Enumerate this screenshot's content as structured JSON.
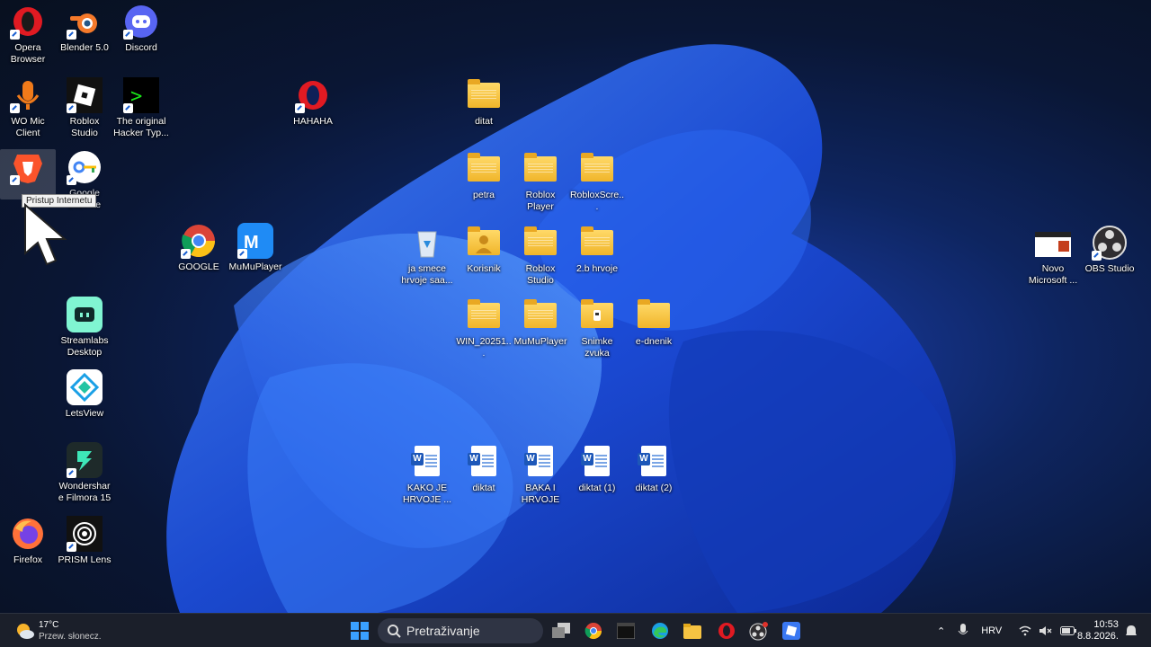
{
  "desktop": {
    "tooltip": "Pristup Internetu",
    "icons": [
      {
        "label": "Opera Browser"
      },
      {
        "label": "Blender 5.0"
      },
      {
        "label": "Discord"
      },
      {
        "label": "WO Mic Client"
      },
      {
        "label": "Roblox Studio"
      },
      {
        "label": "The original Hacker Typ..."
      },
      {
        "label": "HAHAHA"
      },
      {
        "label": "Brave"
      },
      {
        "label": "Google Lozinke"
      },
      {
        "label": "GOOGLE"
      },
      {
        "label": "MuMuPlayer"
      },
      {
        "label": "Streamlabs Desktop"
      },
      {
        "label": "LetsView"
      },
      {
        "label": "Wondershare Filmora 15"
      },
      {
        "label": "Firefox"
      },
      {
        "label": "PRISM Lens"
      },
      {
        "label": "ditat"
      },
      {
        "label": "petra"
      },
      {
        "label": "Roblox Player"
      },
      {
        "label": "RobloxScre..."
      },
      {
        "label": "ja smece hrvoje saa..."
      },
      {
        "label": "Korisnik"
      },
      {
        "label": "Roblox Studio"
      },
      {
        "label": "2.b hrvoje"
      },
      {
        "label": "WIN_20251..."
      },
      {
        "label": "MuMuPlayer"
      },
      {
        "label": "Snimke zvuka"
      },
      {
        "label": "e-dnenik"
      },
      {
        "label": "KAKO JE HRVOJE ..."
      },
      {
        "label": "diktat"
      },
      {
        "label": "BAKA I HRVOJE"
      },
      {
        "label": "diktat (1)"
      },
      {
        "label": "diktat (2)"
      },
      {
        "label": "Novo Microsoft ..."
      },
      {
        "label": "OBS Studio"
      }
    ]
  },
  "taskbar": {
    "weather_temp": "17°C",
    "weather_desc": "Przew. słonecz.",
    "search_placeholder": "Pretraživanje",
    "language": "HRV",
    "time": "10:53",
    "date": "8.8.2026."
  },
  "colors": {
    "taskbar_bg": "#1b1f2a",
    "accent": "#1d57b8"
  }
}
